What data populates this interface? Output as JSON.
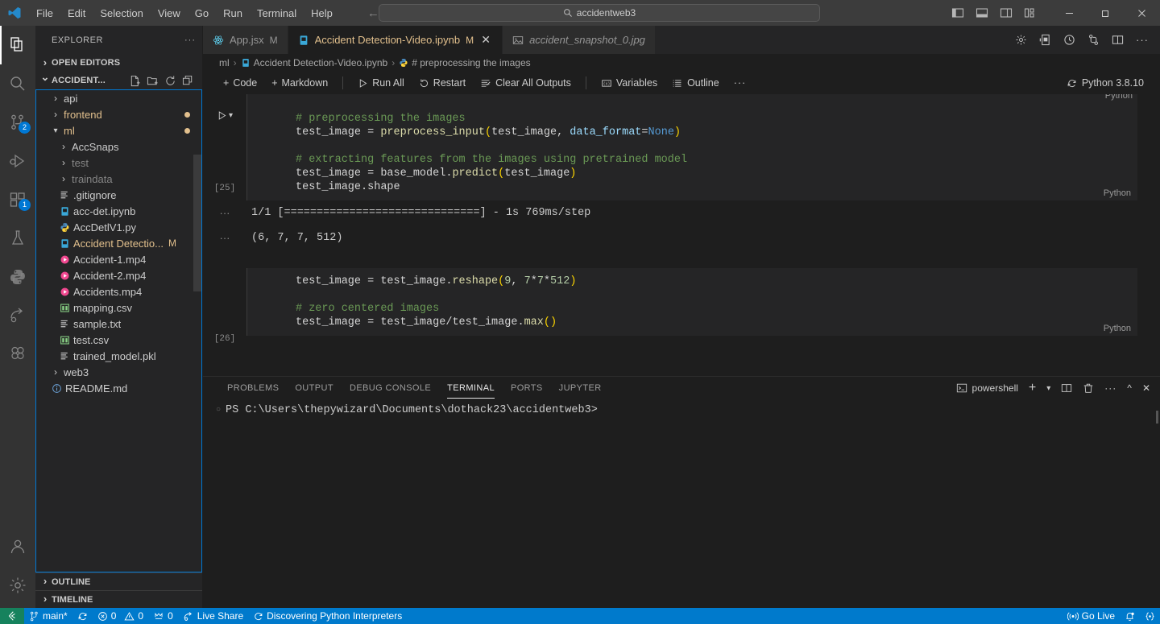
{
  "titlebar": {
    "logo_icon": "vscode-logo-icon",
    "menus": [
      "File",
      "Edit",
      "Selection",
      "View",
      "Go",
      "Run",
      "Terminal",
      "Help"
    ],
    "nav_back_icon": "arrow-left-icon",
    "nav_forward_icon": "arrow-right-icon",
    "search": {
      "icon": "search-icon",
      "value": "accidentweb3"
    },
    "layout_icons": [
      "toggle-primary-sidebar-icon",
      "toggle-panel-icon",
      "toggle-secondary-sidebar-icon",
      "customize-layout-icon"
    ],
    "window_controls": [
      "minimize-icon",
      "maximize-icon",
      "close-icon"
    ]
  },
  "activitybar": {
    "items": [
      {
        "name": "explorer",
        "icon": "files-icon",
        "active": true,
        "badge": ""
      },
      {
        "name": "search",
        "icon": "search-icon",
        "active": false,
        "badge": ""
      },
      {
        "name": "source-control",
        "icon": "source-control-icon",
        "active": false,
        "badge": "2"
      },
      {
        "name": "run-and-debug",
        "icon": "run-debug-icon",
        "active": false,
        "badge": ""
      },
      {
        "name": "extensions",
        "icon": "extensions-icon",
        "active": false,
        "badge": "1"
      },
      {
        "name": "testing",
        "icon": "beaker-icon",
        "active": false,
        "badge": ""
      },
      {
        "name": "python",
        "icon": "python-icon",
        "active": false,
        "badge": ""
      },
      {
        "name": "share",
        "icon": "live-share-icon",
        "active": false,
        "badge": ""
      },
      {
        "name": "figma",
        "icon": "figma-icon",
        "active": false,
        "badge": ""
      }
    ],
    "bottom_items": [
      {
        "name": "accounts",
        "icon": "account-icon"
      },
      {
        "name": "settings",
        "icon": "gear-icon"
      }
    ]
  },
  "sidebar": {
    "title": "EXPLORER",
    "more_actions_icon": "ellipsis-icon",
    "open_editors": {
      "label": "OPEN EDITORS",
      "collapsed": true
    },
    "workspace": {
      "label": "ACCIDENT...",
      "collapsed": false,
      "actions": [
        "new-file-icon",
        "new-folder-icon",
        "refresh-icon",
        "collapse-all-icon"
      ]
    },
    "tree": [
      {
        "label": "api",
        "type": "folder",
        "indent": 1,
        "expanded": false,
        "icon": "chevron-right-icon",
        "modified": false,
        "dim": false,
        "dot": false,
        "badge": ""
      },
      {
        "label": "frontend",
        "type": "folder",
        "indent": 1,
        "expanded": false,
        "icon": "chevron-right-icon",
        "modified": true,
        "dim": false,
        "dot": true,
        "badge": ""
      },
      {
        "label": "ml",
        "type": "folder",
        "indent": 1,
        "expanded": true,
        "icon": "chevron-down-icon",
        "modified": true,
        "dim": false,
        "dot": true,
        "badge": ""
      },
      {
        "label": "AccSnaps",
        "type": "folder",
        "indent": 2,
        "expanded": false,
        "icon": "chevron-right-icon",
        "modified": false,
        "dim": false,
        "dot": false,
        "badge": ""
      },
      {
        "label": "test",
        "type": "folder",
        "indent": 2,
        "expanded": false,
        "icon": "chevron-right-icon",
        "modified": false,
        "dim": true,
        "dot": false,
        "badge": ""
      },
      {
        "label": "traindata",
        "type": "folder",
        "indent": 2,
        "expanded": false,
        "icon": "chevron-right-icon",
        "modified": false,
        "dim": true,
        "dot": false,
        "badge": ""
      },
      {
        "label": ".gitignore",
        "type": "file-text",
        "indent": 2,
        "expanded": false,
        "icon": "text-file-icon",
        "modified": false,
        "dim": false,
        "dot": false,
        "badge": ""
      },
      {
        "label": "acc-det.ipynb",
        "type": "notebook",
        "indent": 2,
        "expanded": false,
        "icon": "notebook-icon",
        "modified": false,
        "dim": false,
        "dot": false,
        "badge": ""
      },
      {
        "label": "AccDetlV1.py",
        "type": "python",
        "indent": 2,
        "expanded": false,
        "icon": "python-icon",
        "modified": false,
        "dim": false,
        "dot": false,
        "badge": ""
      },
      {
        "label": "Accident Detectio...",
        "type": "notebook",
        "indent": 2,
        "expanded": false,
        "icon": "notebook-icon",
        "modified": true,
        "dim": false,
        "dot": false,
        "badge": "M"
      },
      {
        "label": "Accident-1.mp4",
        "type": "video",
        "indent": 2,
        "expanded": false,
        "icon": "video-icon",
        "modified": false,
        "dim": false,
        "dot": false,
        "badge": ""
      },
      {
        "label": "Accident-2.mp4",
        "type": "video",
        "indent": 2,
        "expanded": false,
        "icon": "video-icon",
        "modified": false,
        "dim": false,
        "dot": false,
        "badge": ""
      },
      {
        "label": "Accidents.mp4",
        "type": "video",
        "indent": 2,
        "expanded": false,
        "icon": "video-icon",
        "modified": false,
        "dim": false,
        "dot": false,
        "badge": ""
      },
      {
        "label": "mapping.csv",
        "type": "csv",
        "indent": 2,
        "expanded": false,
        "icon": "table-icon",
        "modified": false,
        "dim": false,
        "dot": false,
        "badge": ""
      },
      {
        "label": "sample.txt",
        "type": "file-text",
        "indent": 2,
        "expanded": false,
        "icon": "text-file-icon",
        "modified": false,
        "dim": false,
        "dot": false,
        "badge": ""
      },
      {
        "label": "test.csv",
        "type": "csv",
        "indent": 2,
        "expanded": false,
        "icon": "table-icon",
        "modified": false,
        "dim": false,
        "dot": false,
        "badge": ""
      },
      {
        "label": "trained_model.pkl",
        "type": "file-text",
        "indent": 2,
        "expanded": false,
        "icon": "text-file-icon",
        "modified": false,
        "dim": false,
        "dot": false,
        "badge": ""
      },
      {
        "label": "web3",
        "type": "folder",
        "indent": 1,
        "expanded": false,
        "icon": "chevron-right-icon",
        "modified": false,
        "dim": false,
        "dot": false,
        "badge": ""
      },
      {
        "label": "README.md",
        "type": "markdown",
        "indent": 1,
        "expanded": false,
        "icon": "info-icon",
        "modified": false,
        "dim": false,
        "dot": false,
        "badge": ""
      }
    ],
    "bottom_sections": [
      {
        "label": "OUTLINE",
        "collapsed": true
      },
      {
        "label": "TIMELINE",
        "collapsed": true
      }
    ]
  },
  "editor": {
    "tabs": [
      {
        "label": "App.jsx",
        "icon": "react-icon",
        "modified_flag": "M",
        "active": false,
        "italic": false,
        "closable": false
      },
      {
        "label": "Accident Detection-Video.ipynb",
        "icon": "notebook-icon",
        "modified_flag": "M",
        "active": true,
        "italic": false,
        "closable": true
      },
      {
        "label": "accident_snapshot_0.jpg",
        "icon": "image-icon",
        "modified_flag": "",
        "active": false,
        "italic": true,
        "closable": false
      }
    ],
    "tab_close_icon": "close-icon",
    "actions": [
      "gear-icon",
      "split-notebook-icon",
      "timeline-icon",
      "source-control-compare-icon",
      "split-editor-icon",
      "ellipsis-icon"
    ],
    "breadcrumb": [
      {
        "label": "ml",
        "icon": ""
      },
      {
        "label": "Accident Detection-Video.ipynb",
        "icon": "notebook-icon"
      },
      {
        "label": "# preprocessing the images",
        "icon": "python-icon"
      }
    ],
    "breadcrumb_separator": "›"
  },
  "notebook_toolbar": {
    "buttons": [
      {
        "label": "Code",
        "icon": "plus-icon"
      },
      {
        "label": "Markdown",
        "icon": "plus-icon"
      },
      {
        "label": "Run All",
        "icon": "play-icon"
      },
      {
        "label": "Restart",
        "icon": "restart-icon"
      },
      {
        "label": "Clear All Outputs",
        "icon": "clear-outputs-icon"
      },
      {
        "label": "Variables",
        "icon": "variables-icon"
      },
      {
        "label": "Outline",
        "icon": "outline-icon"
      }
    ],
    "more_icon": "ellipsis-icon",
    "kernel": {
      "label": "Python 3.8.10",
      "icon": "kernel-restart-icon"
    }
  },
  "notebook": {
    "hover_toolbar_icons": [
      "execute-above-icon",
      "run-by-line-icon",
      "execute-cell-and-below-icon",
      "split-cell-icon",
      "more-actions-icon",
      "delete-cell-icon"
    ],
    "cells": [
      {
        "exec_count": "[25]",
        "language": "Python",
        "run_icon": "play-icon",
        "expand_icon": "chevron-down-icon",
        "lines": [
          [
            {
              "t": "# preprocessing the images",
              "c": "tok-com"
            }
          ],
          [
            {
              "t": "test_image ",
              "c": "tok-plain"
            },
            {
              "t": "= ",
              "c": "tok-op"
            },
            {
              "t": "preprocess_input",
              "c": "tok-fn"
            },
            {
              "t": "(",
              "c": "tok-par"
            },
            {
              "t": "test_image",
              "c": "tok-plain"
            },
            {
              "t": ", ",
              "c": "tok-op"
            },
            {
              "t": "data_format",
              "c": "tok-var"
            },
            {
              "t": "=",
              "c": "tok-op"
            },
            {
              "t": "None",
              "c": "tok-kw"
            },
            {
              "t": ")",
              "c": "tok-par"
            }
          ],
          [
            {
              "t": " ",
              "c": "tok-plain"
            }
          ],
          [
            {
              "t": "# extracting features from the images using pretrained model",
              "c": "tok-com"
            }
          ],
          [
            {
              "t": "test_image ",
              "c": "tok-plain"
            },
            {
              "t": "= ",
              "c": "tok-op"
            },
            {
              "t": "base_model.",
              "c": "tok-plain"
            },
            {
              "t": "predict",
              "c": "tok-fn"
            },
            {
              "t": "(",
              "c": "tok-par"
            },
            {
              "t": "test_image",
              "c": "tok-plain"
            },
            {
              "t": ")",
              "c": "tok-par"
            }
          ],
          [
            {
              "t": "test_image.shape",
              "c": "tok-plain"
            }
          ]
        ],
        "outputs": [
          {
            "dots": "···",
            "text": "1/1 [==============================] - 1s 769ms/step"
          },
          {
            "dots": "···",
            "text": "(6, 7, 7, 512)"
          }
        ]
      },
      {
        "exec_count": "[26]",
        "language": "Python",
        "run_icon": "play-icon",
        "expand_icon": "chevron-down-icon",
        "lines": [
          [
            {
              "t": "test_image ",
              "c": "tok-plain"
            },
            {
              "t": "= ",
              "c": "tok-op"
            },
            {
              "t": "test_image.",
              "c": "tok-plain"
            },
            {
              "t": "reshape",
              "c": "tok-fn"
            },
            {
              "t": "(",
              "c": "tok-par"
            },
            {
              "t": "9",
              "c": "tok-num"
            },
            {
              "t": ", ",
              "c": "tok-op"
            },
            {
              "t": "7",
              "c": "tok-num"
            },
            {
              "t": "*",
              "c": "tok-op"
            },
            {
              "t": "7",
              "c": "tok-num"
            },
            {
              "t": "*",
              "c": "tok-op"
            },
            {
              "t": "512",
              "c": "tok-num"
            },
            {
              "t": ")",
              "c": "tok-par"
            }
          ],
          [
            {
              "t": " ",
              "c": "tok-plain"
            }
          ],
          [
            {
              "t": "# zero centered images",
              "c": "tok-com"
            }
          ],
          [
            {
              "t": "test_image ",
              "c": "tok-plain"
            },
            {
              "t": "= ",
              "c": "tok-op"
            },
            {
              "t": "test_image/test_image.",
              "c": "tok-plain"
            },
            {
              "t": "max",
              "c": "tok-fn"
            },
            {
              "t": "(",
              "c": "tok-par"
            },
            {
              "t": ")",
              "c": "tok-par"
            }
          ],
          [
            {
              "t": " ",
              "c": "tok-plain"
            }
          ]
        ],
        "outputs": []
      }
    ]
  },
  "panel": {
    "tabs": [
      {
        "label": "PROBLEMS",
        "active": false
      },
      {
        "label": "OUTPUT",
        "active": false
      },
      {
        "label": "DEBUG CONSOLE",
        "active": false
      },
      {
        "label": "TERMINAL",
        "active": true
      },
      {
        "label": "PORTS",
        "active": false
      },
      {
        "label": "JUPYTER",
        "active": false
      }
    ],
    "terminal_name": "powershell",
    "terminal_icon": "terminal-icon",
    "actions": [
      "new-terminal-icon",
      "chevron-down-icon",
      "split-terminal-icon",
      "kill-terminal-icon",
      "ellipsis-icon",
      "maximize-panel-icon",
      "close-panel-icon"
    ],
    "terminal_lines": [
      {
        "bullet": "○",
        "text": "PS C:\\Users\\thepywizard\\Documents\\dothack23\\accidentweb3>"
      }
    ]
  },
  "statusbar": {
    "remote_icon": "remote-indicator-icon",
    "left_items": [
      {
        "icon": "source-control-branch-icon",
        "label": "main*"
      },
      {
        "icon": "sync-icon",
        "label": ""
      },
      {
        "icon": "error-icon",
        "label": "0",
        "icon2": "warning-icon",
        "label2": "0"
      },
      {
        "icon": "ports-icon",
        "label": "0"
      },
      {
        "icon": "live-share-icon",
        "label": "Live Share"
      },
      {
        "icon": "loading-icon",
        "label": "Discovering Python Interpreters"
      }
    ],
    "right_items": [
      {
        "icon": "broadcast-icon",
        "label": "Go Live"
      },
      {
        "icon": "bell-dot-icon",
        "label": ""
      },
      {
        "icon": "tabnine-icon",
        "label": ""
      }
    ]
  },
  "colors": {
    "accent": "#007acc",
    "titlebar_bg": "#3c3c3c",
    "sidebar_bg": "#252526",
    "editor_bg": "#1e1e1e",
    "modified_fg": "#e2c08d",
    "badge_bg": "#0078d4",
    "remote_bg": "#16825d"
  }
}
